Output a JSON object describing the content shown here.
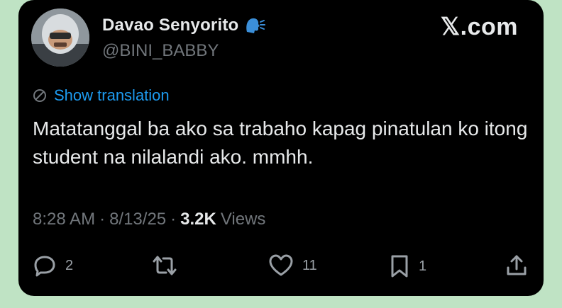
{
  "author": {
    "display_name": "Davao Senyorito",
    "handle": "@BINI_BABBY"
  },
  "brand": "𝕏.com",
  "translation_label": "Show translation",
  "tweet_text": "Matatanggal ba ako sa trabaho kapag pinatulan ko itong student na nilalandi ako. mmhh.",
  "meta": {
    "time": "8:28 AM",
    "date": "8/13/25",
    "views_count": "3.2K",
    "views_label": "Views"
  },
  "actions": {
    "reply_count": "2",
    "repost_count": "",
    "like_count": "11",
    "bookmark_count": "1"
  },
  "colors": {
    "background": "#bfe3c4",
    "card": "#000000",
    "accent": "#1d9bf0",
    "muted": "#71767b",
    "text": "#e7e9ea"
  },
  "icons": [
    "avatar",
    "speaking-head-icon",
    "x-logo",
    "globe-icon",
    "reply-icon",
    "repost-icon",
    "like-icon",
    "bookmark-icon",
    "share-icon"
  ]
}
